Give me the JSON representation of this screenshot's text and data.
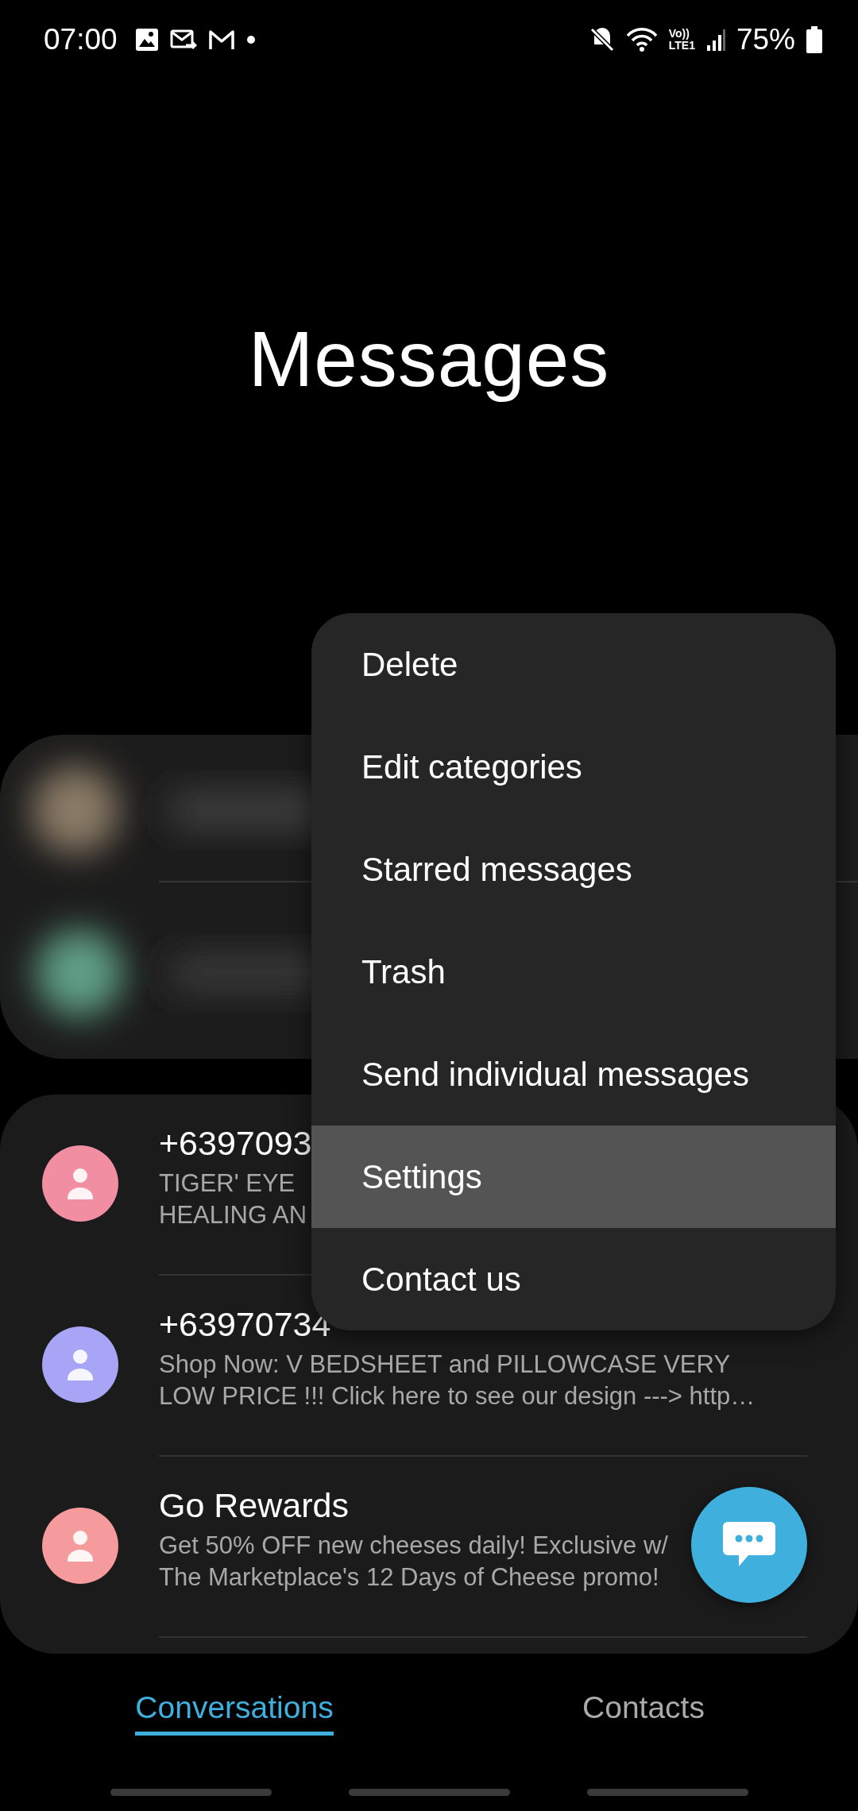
{
  "status_bar": {
    "time": "07:00",
    "network_label": [
      "Vo))",
      "LTE1"
    ],
    "battery": "75%"
  },
  "title": "Messages",
  "conversations": [
    {
      "name": "+6397093",
      "color": "#f28ea2",
      "preview": [
        "TIGER' EYE",
        "HEALING AN"
      ]
    },
    {
      "name": "+63970734",
      "color": "#a8a4f6",
      "preview": [
        "Shop Now: V BEDSHEET and PILLOWCASE  VERY",
        "LOW PRICE !!!  Click here to see our design ---> http…"
      ]
    },
    {
      "name": "Go Rewards",
      "color": "#f59b9d",
      "preview": [
        "Get 50% OFF new cheeses daily! Exclusive w/",
        "The Marketplace's 12 Days of Cheese promo!"
      ]
    }
  ],
  "menu": [
    {
      "label": "Delete",
      "selected": false
    },
    {
      "label": "Edit categories",
      "selected": false
    },
    {
      "label": "Starred messages",
      "selected": false
    },
    {
      "label": "Trash",
      "selected": false
    },
    {
      "label": "Send individual messages",
      "selected": false
    },
    {
      "label": "Settings",
      "selected": true
    },
    {
      "label": "Contact us",
      "selected": false
    }
  ],
  "tabs": [
    {
      "label": "Conversations",
      "selected": true
    },
    {
      "label": "Contacts",
      "selected": false
    }
  ]
}
